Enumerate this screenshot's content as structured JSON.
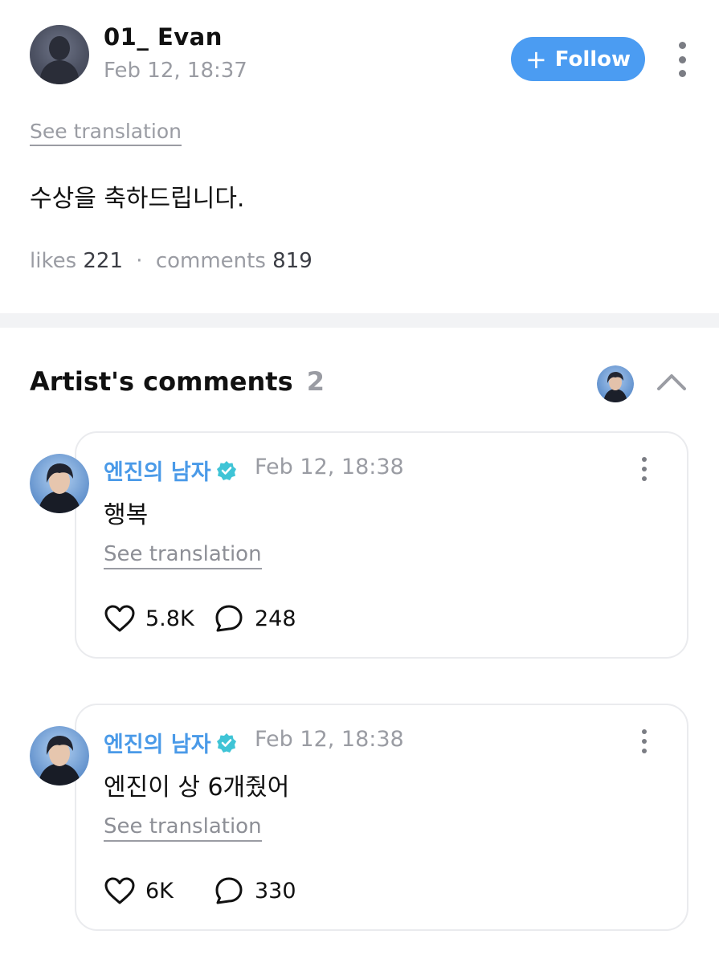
{
  "post": {
    "author": "01_ Evan",
    "date": "Feb 12, 18:37",
    "follow_label": "Follow",
    "see_translation": "See translation",
    "body": "수상을 축하드립니다.",
    "likes_label": "likes",
    "likes_count": "221",
    "separator": "·",
    "comments_label": "comments",
    "comments_count": "819"
  },
  "artist_comments": {
    "title": "Artist's comments",
    "count": "2",
    "items": [
      {
        "name": "엔진의 남자",
        "date": "Feb 12, 18:38",
        "text": "행복",
        "see_translation": "See translation",
        "likes": "5.8K",
        "replies": "248"
      },
      {
        "name": "엔진의 남자",
        "date": "Feb 12, 18:38",
        "text": "엔진이 상 6개줬어",
        "see_translation": "See translation",
        "likes": "6K",
        "replies": "330"
      }
    ]
  },
  "colors": {
    "accent": "#4b9cf2",
    "artist_name": "#4a9ae8",
    "verified_badge": "#3fc4d6",
    "muted_text": "#9a9ca3"
  },
  "icons": [
    "more-vertical-icon",
    "plus-icon",
    "verified-badge-icon",
    "chevron-up-icon",
    "heart-icon",
    "speech-bubble-icon"
  ]
}
